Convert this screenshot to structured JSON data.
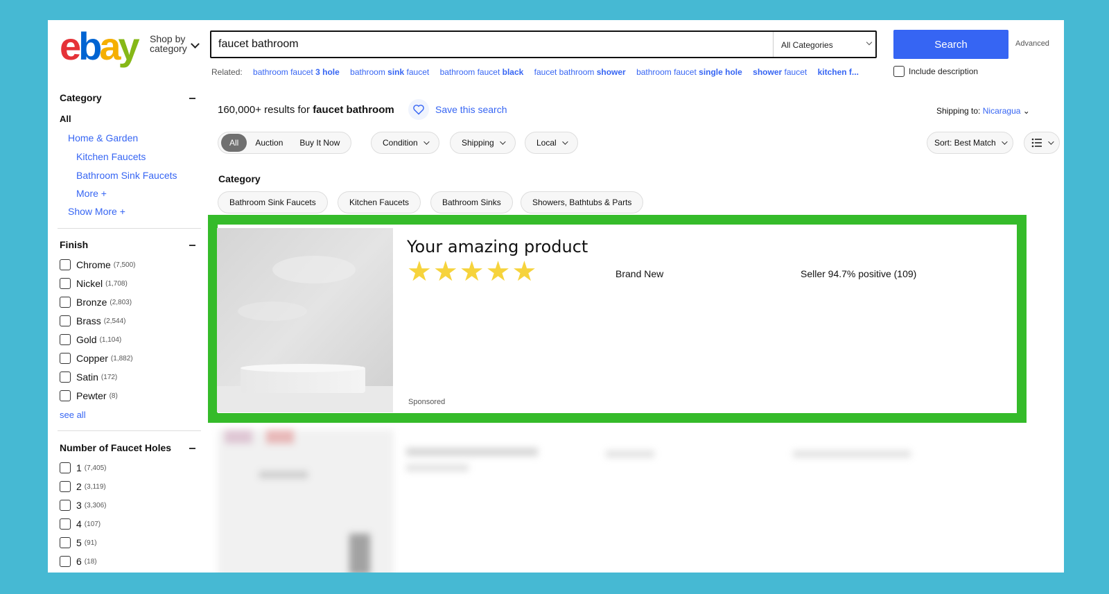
{
  "header": {
    "logo": {
      "e": "e",
      "b": "b",
      "a": "a",
      "y": "y"
    },
    "shop_by_line1": "Shop by",
    "shop_by_line2": "category",
    "search_value": "faucet bathroom",
    "category_select": "All Categories",
    "search_button": "Search",
    "advanced": "Advanced"
  },
  "related": {
    "label": "Related:",
    "links": [
      {
        "pre": "bathroom faucet ",
        "bold": "3 hole"
      },
      {
        "pre": "bathroom ",
        "bold": "sink",
        "post": " faucet"
      },
      {
        "pre": "bathroom faucet ",
        "bold": "black"
      },
      {
        "pre": "faucet bathroom ",
        "bold": "shower"
      },
      {
        "pre": "bathroom faucet ",
        "bold": "single hole"
      },
      {
        "pre": "",
        "bold": "shower",
        "post": " faucet"
      },
      {
        "pre": "",
        "bold": "kitchen f..."
      }
    ],
    "include_description": "Include description"
  },
  "sidebar": {
    "category_heading": "Category",
    "all": "All",
    "home_garden": "Home & Garden",
    "kitchen_faucets": "Kitchen Faucets",
    "bathroom_sink_faucets": "Bathroom Sink Faucets",
    "more": "More",
    "show_more": "Show More",
    "finish_heading": "Finish",
    "finish": [
      {
        "label": "Chrome",
        "count": "(7,500)"
      },
      {
        "label": "Nickel",
        "count": "(1,708)"
      },
      {
        "label": "Bronze",
        "count": "(2,803)"
      },
      {
        "label": "Brass",
        "count": "(2,544)"
      },
      {
        "label": "Gold",
        "count": "(1,104)"
      },
      {
        "label": "Copper",
        "count": "(1,882)"
      },
      {
        "label": "Satin",
        "count": "(172)"
      },
      {
        "label": "Pewter",
        "count": "(8)"
      }
    ],
    "see_all": "see all",
    "holes_heading": "Number of Faucet Holes",
    "holes": [
      {
        "label": "1",
        "count": "(7,405)"
      },
      {
        "label": "2",
        "count": "(3,119)"
      },
      {
        "label": "3",
        "count": "(3,306)"
      },
      {
        "label": "4",
        "count": "(107)"
      },
      {
        "label": "5",
        "count": "(91)"
      },
      {
        "label": "6",
        "count": "(18)"
      }
    ]
  },
  "main": {
    "results_count": "160,000+ results for",
    "results_query": "faucet bathroom",
    "save_search": "Save this search",
    "shipping_label": "Shipping to:",
    "shipping_country": "Nicaragua",
    "format_tabs": [
      "All",
      "Auction",
      "Buy It Now"
    ],
    "filters": [
      "Condition",
      "Shipping",
      "Local"
    ],
    "sort": "Sort: Best Match",
    "category_heading": "Category",
    "category_pills": [
      "Bathroom Sink Faucets",
      "Kitchen Faucets",
      "Bathroom Sinks",
      "Showers, Bathtubs & Parts"
    ]
  },
  "featured": {
    "title": "Your amazing product",
    "stars": "★★★★★",
    "rating": 5,
    "condition": "Brand New",
    "seller": "Seller 94.7% positive (109)",
    "sponsored": "Sponsored"
  },
  "colors": {
    "accent": "#3665f3",
    "highlight_frame": "#35bb2a",
    "background": "#46b9d3",
    "star": "#f6d33c"
  }
}
